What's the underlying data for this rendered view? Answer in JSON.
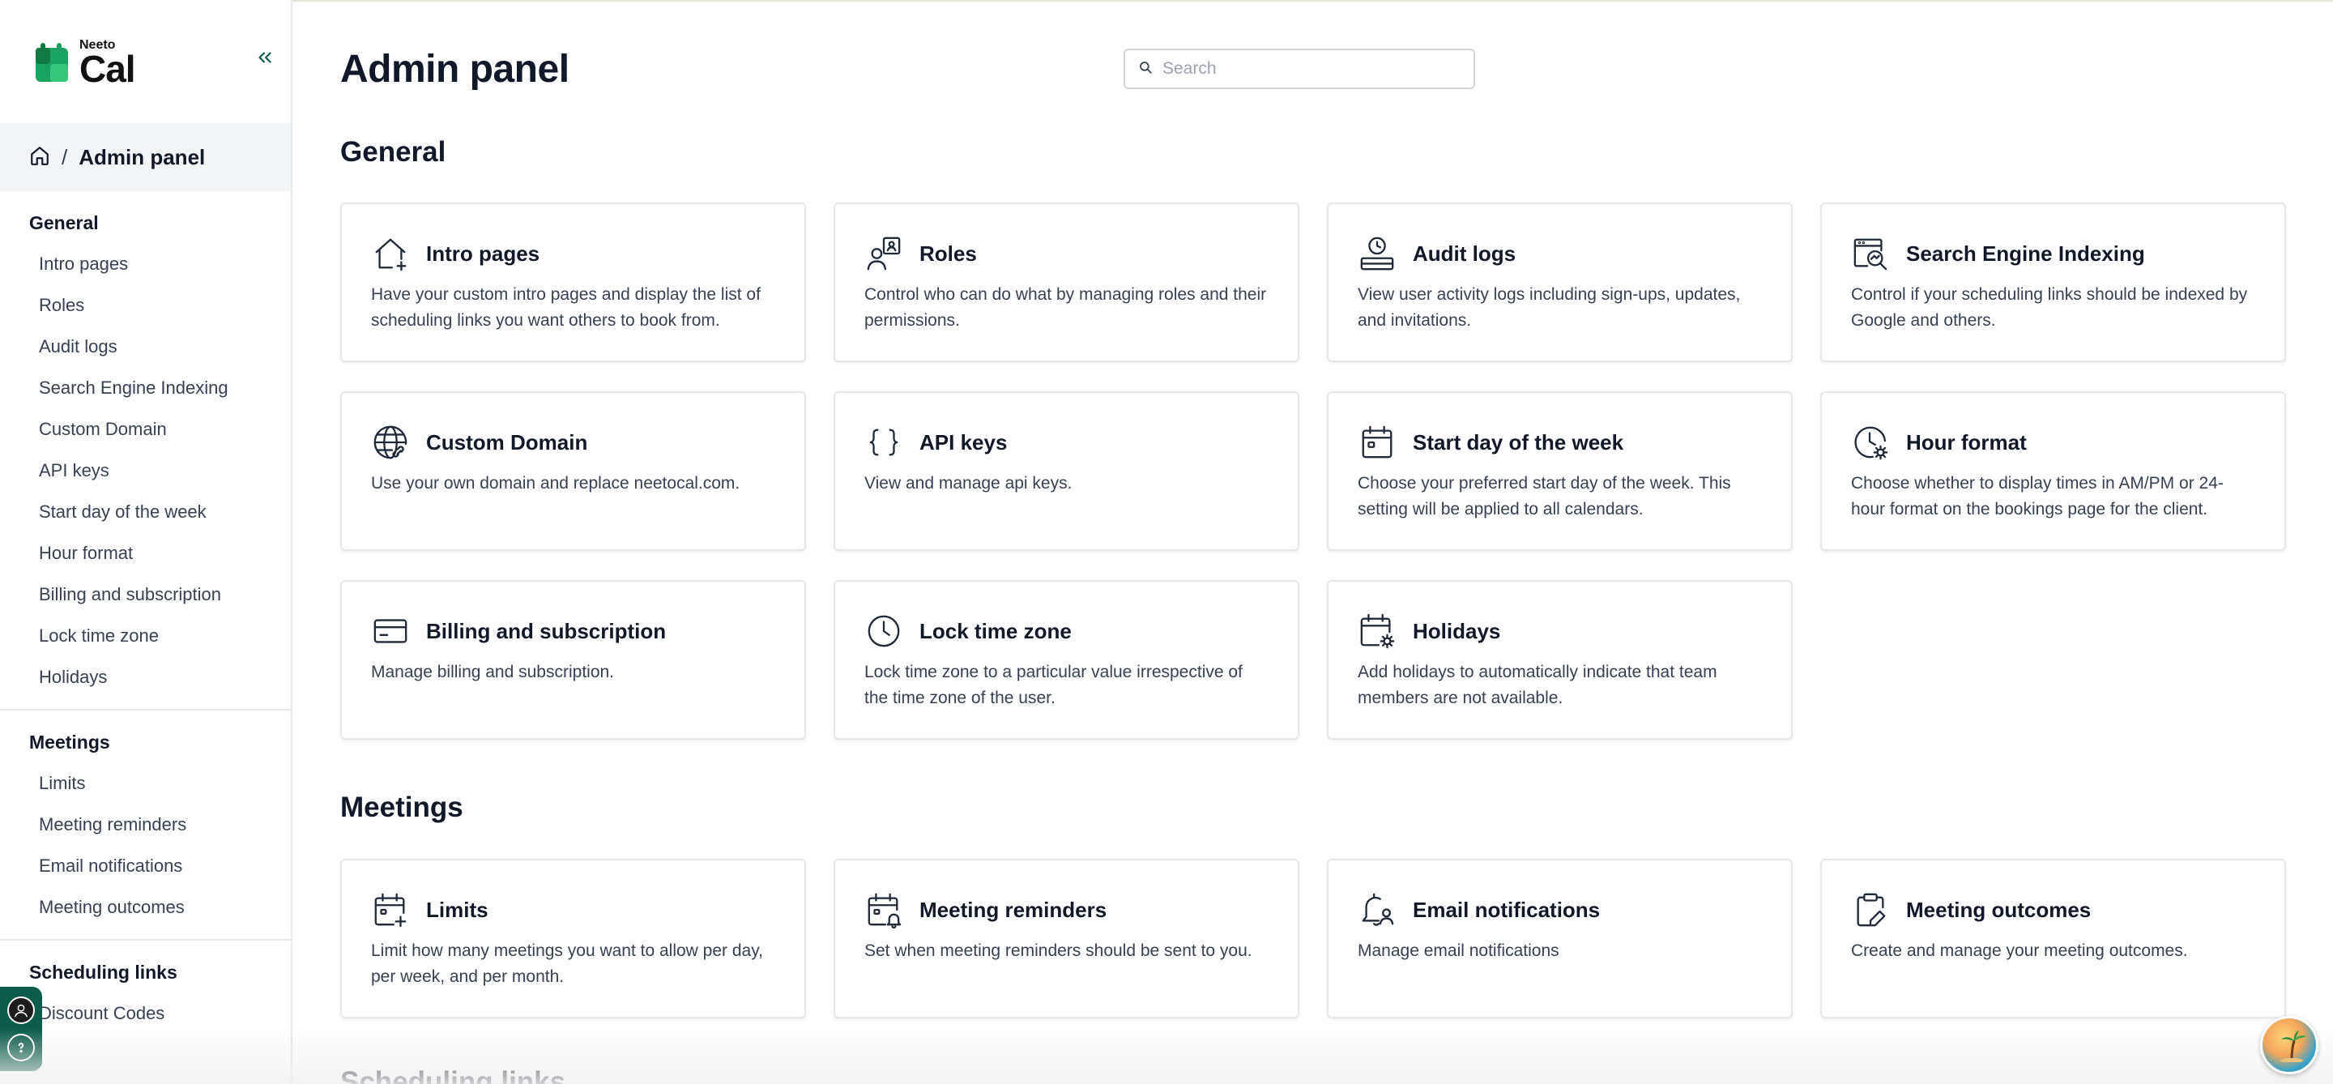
{
  "app": {
    "logo_small": "Neeto",
    "logo_big": "Cal"
  },
  "breadcrumb": {
    "separator": "/",
    "current": "Admin panel"
  },
  "sidebar": {
    "sections": [
      {
        "heading": "General",
        "items": [
          "Intro pages",
          "Roles",
          "Audit logs",
          "Search Engine Indexing",
          "Custom Domain",
          "API keys",
          "Start day of the week",
          "Hour format",
          "Billing and subscription",
          "Lock time zone",
          "Holidays"
        ]
      },
      {
        "heading": "Meetings",
        "items": [
          "Limits",
          "Meeting reminders",
          "Email notifications",
          "Meeting outcomes"
        ]
      },
      {
        "heading": "Scheduling links",
        "items": [
          "Discount Codes"
        ]
      }
    ]
  },
  "header": {
    "title": "Admin panel",
    "search_placeholder": "Search"
  },
  "general": {
    "title": "General",
    "cards": [
      {
        "title": "Intro pages",
        "desc": "Have your custom intro pages and display the list of scheduling links you want others to book from.",
        "icon": "home-plus-icon"
      },
      {
        "title": "Roles",
        "desc": "Control who can do what by managing roles and their permissions.",
        "icon": "user-roles-icon"
      },
      {
        "title": "Audit logs",
        "desc": "View user activity logs including sign-ups, updates, and invitations.",
        "icon": "audit-log-icon"
      },
      {
        "title": "Search Engine Indexing",
        "desc": "Control if your scheduling links should be indexed by Google and others.",
        "icon": "search-engine-icon"
      },
      {
        "title": "Custom Domain",
        "desc": "Use your own domain and replace neetocal.com.",
        "icon": "globe-link-icon"
      },
      {
        "title": "API keys",
        "desc": "View and manage api keys.",
        "icon": "code-braces-icon"
      },
      {
        "title": "Start day of the week",
        "desc": "Choose your preferred start day of the week. This setting will be applied to all calendars.",
        "icon": "calendar-icon"
      },
      {
        "title": "Hour format",
        "desc": "Choose whether to display times in AM/PM or 24-hour format on the bookings page for the client.",
        "icon": "clock-gear-icon"
      },
      {
        "title": "Billing and subscription",
        "desc": "Manage billing and subscription.",
        "icon": "credit-card-icon"
      },
      {
        "title": "Lock time zone",
        "desc": "Lock time zone to a particular value irrespective of the time zone of the user.",
        "icon": "clock-icon"
      },
      {
        "title": "Holidays",
        "desc": "Add holidays to automatically indicate that team members are not available.",
        "icon": "calendar-gear-icon"
      }
    ]
  },
  "meetings": {
    "title": "Meetings",
    "cards": [
      {
        "title": "Limits",
        "desc": "Limit how many meetings you want to allow per day, per week, and per month.",
        "icon": "calendar-plus-icon"
      },
      {
        "title": "Meeting reminders",
        "desc": "Set when meeting reminders should be sent to you.",
        "icon": "calendar-bell-icon"
      },
      {
        "title": "Email notifications",
        "desc": "Manage email notifications",
        "icon": "bell-user-icon"
      },
      {
        "title": "Meeting outcomes",
        "desc": "Create and manage your meeting outcomes.",
        "icon": "clipboard-edit-icon"
      }
    ]
  },
  "scheduling": {
    "title": "Scheduling links"
  },
  "colors": {
    "brand_green": "#1aa360",
    "brand_dark_green": "#0d5c4a",
    "text_dark": "#111827",
    "border": "#e5e7eb"
  }
}
